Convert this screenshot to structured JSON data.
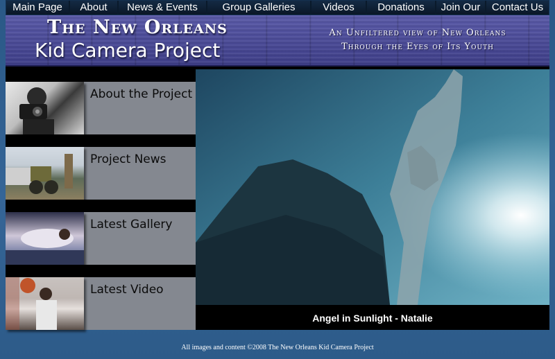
{
  "nav": {
    "items": [
      {
        "label": "Main Page"
      },
      {
        "label": "About"
      },
      {
        "label": "News & Events"
      },
      {
        "label": "Group Galleries"
      },
      {
        "label": "Videos"
      },
      {
        "label": "Donations"
      },
      {
        "label": "Join Our"
      },
      {
        "label": "Contact Us"
      }
    ]
  },
  "banner": {
    "title_line1": "The New Orleans",
    "title_line2": "Kid Camera Project",
    "tagline_line1": "An Unfiltered view of New Orleans",
    "tagline_line2": "Through the Eyes of Its Youth"
  },
  "sidebar": {
    "items": [
      {
        "label": "About the Project"
      },
      {
        "label": "Project News"
      },
      {
        "label": "Latest Gallery"
      },
      {
        "label": "Latest Video"
      }
    ]
  },
  "feature": {
    "caption": "Angel in Sunlight - Natalie"
  },
  "footer": {
    "text": "All images and content ©2008 The New Orleans Kid Camera Project"
  },
  "colors": {
    "background": "#2f5d8a",
    "nav": "#0b1b2e",
    "banner": "#4b4b98",
    "sidebar_item": "#848890"
  }
}
